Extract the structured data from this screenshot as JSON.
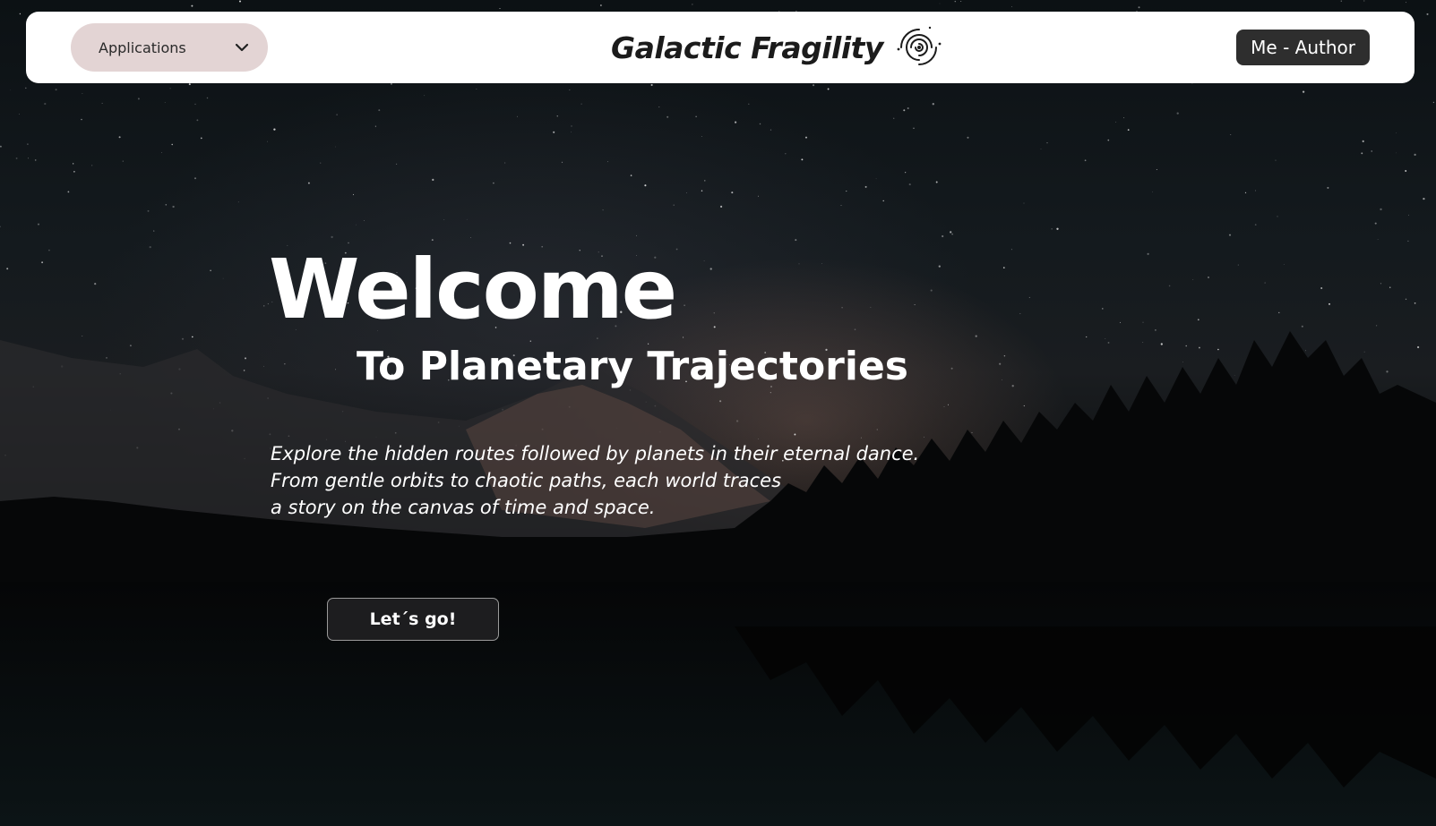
{
  "header": {
    "applications_label": "Applications",
    "brand_title": "Galactic Fragility",
    "author_label": "Me - Author"
  },
  "hero": {
    "title": "Welcome",
    "subtitle": "To Planetary Trajectories",
    "description_lines": [
      "Explore the hidden routes followed by planets in their eternal dance.",
      "From gentle orbits to chaotic paths, each world traces",
      "a story on the canvas of time and space."
    ],
    "cta_label": "Let´s go!"
  },
  "icons": {
    "dropdown": "chevron-down-icon",
    "brand": "galaxy-icon"
  },
  "colors": {
    "header_bg": "#ffffff",
    "apps_button_bg": "#e3d4d4",
    "author_button_bg": "#2e2e2e",
    "cta_bg": "#1d1d1f"
  }
}
